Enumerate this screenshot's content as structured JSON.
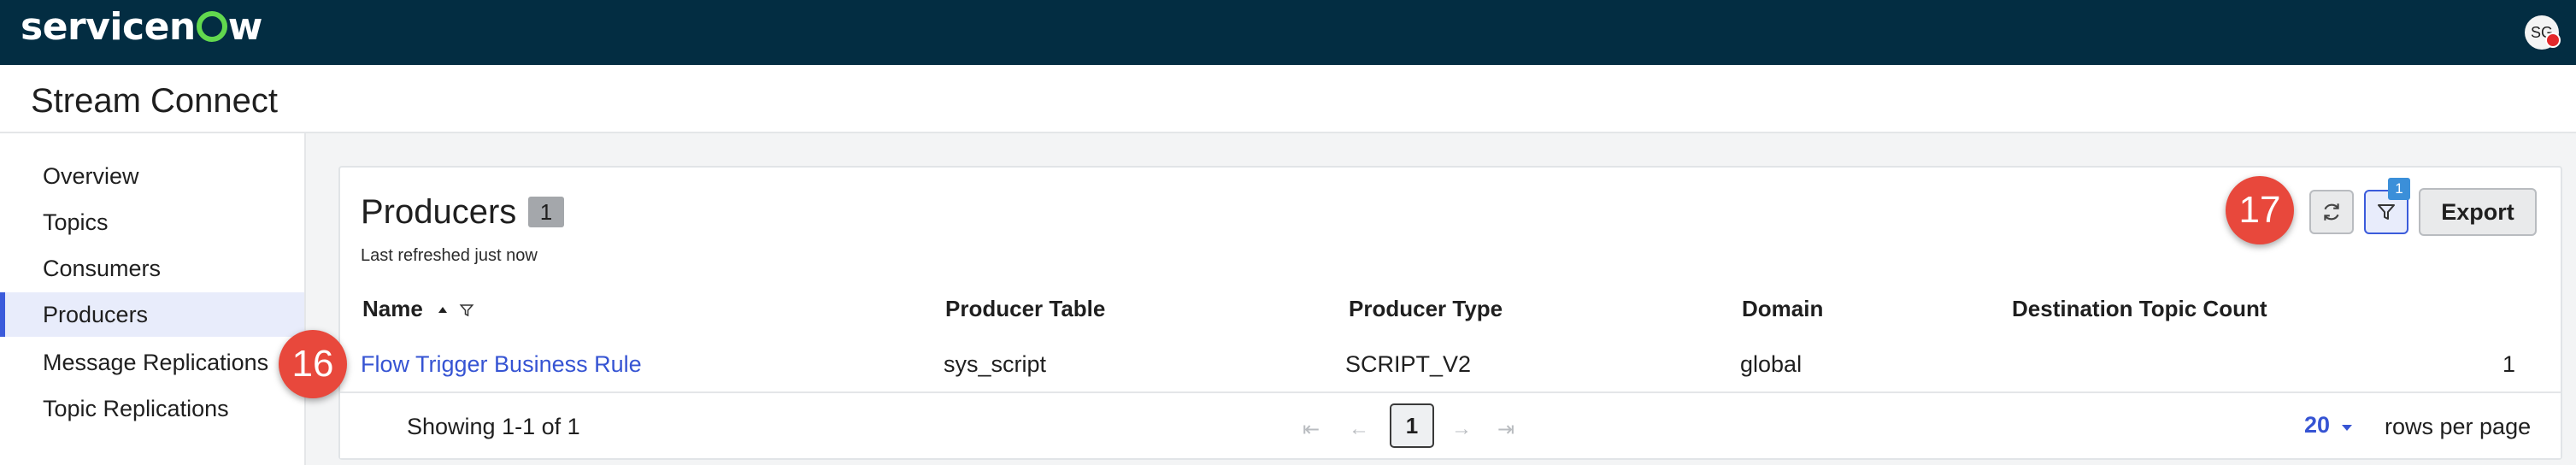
{
  "app": {
    "brand": "servicenow",
    "user_initials": "SG"
  },
  "page": {
    "title": "Stream Connect"
  },
  "sidebar": {
    "items": [
      {
        "label": "Overview"
      },
      {
        "label": "Topics"
      },
      {
        "label": "Consumers"
      },
      {
        "label": "Producers",
        "active": true
      },
      {
        "label": "Message Replications"
      },
      {
        "label": "Topic Replications"
      }
    ]
  },
  "producers": {
    "title": "Producers",
    "count": "1",
    "refreshed": "Last refreshed just now",
    "step_badges": {
      "toolbar": "17",
      "row": "16"
    },
    "filter_count": "1",
    "export_label": "Export",
    "columns": [
      "Name",
      "Producer Table",
      "Producer Type",
      "Domain",
      "Destination Topic Count"
    ],
    "sort": {
      "column": "Name",
      "direction": "asc"
    },
    "rows": [
      {
        "name": "Flow Trigger Business Rule",
        "producer_table": "sys_script",
        "producer_type": "SCRIPT_V2",
        "domain": "global",
        "destination_topic_count": "1"
      }
    ],
    "pagination": {
      "showing": "Showing 1-1 of 1",
      "current_page": "1",
      "rows_per_page": "20",
      "rows_per_page_label": "rows per page"
    }
  },
  "colors": {
    "header_bg": "#032d42",
    "accent": "#3b5bdb",
    "link": "#3654d3",
    "step_badge": "#e8483c",
    "logo_green": "#62d84e"
  },
  "icons": [
    "refresh-icon",
    "filter-icon",
    "sort-asc-icon",
    "first-page-icon",
    "prev-page-icon",
    "next-page-icon",
    "last-page-icon",
    "caret-down-icon"
  ]
}
